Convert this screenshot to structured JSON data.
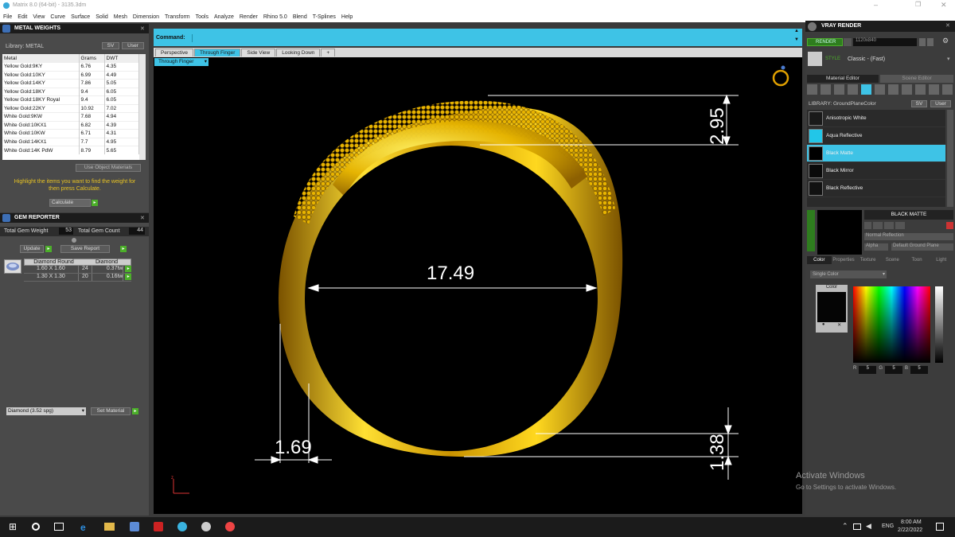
{
  "window": {
    "title": "Matrix 8.0 (64-bit) - 3135.3dm"
  },
  "menu": [
    "File",
    "Edit",
    "View",
    "Curve",
    "Surface",
    "Solid",
    "Mesh",
    "Dimension",
    "Transform",
    "Tools",
    "Analyze",
    "Render",
    "Rhino 5.0",
    "Blend",
    "T-Splines",
    "Help"
  ],
  "metal": {
    "title": "METAL WEIGHTS",
    "library": "Library: METAL",
    "sv": "SV",
    "user": "User",
    "headers": [
      "Metal",
      "Grams",
      "DWT"
    ],
    "rows": [
      [
        "Yellow Gold:9KY",
        "6.76",
        "4.35"
      ],
      [
        "Yellow Gold:10KY",
        "6.99",
        "4.49"
      ],
      [
        "Yellow Gold:14KY",
        "7.86",
        "5.05"
      ],
      [
        "Yellow Gold:18KY",
        "9.4",
        "6.05"
      ],
      [
        "Yellow Gold:18KY Royal",
        "9.4",
        "6.05"
      ],
      [
        "Yellow Gold:22KY",
        "10.92",
        "7.02"
      ],
      [
        "White Gold:9KW",
        "7.68",
        "4.94"
      ],
      [
        "White Gold:10KX1",
        "6.82",
        "4.39"
      ],
      [
        "White Gold:10KW",
        "6.71",
        "4.31"
      ],
      [
        "White Gold:14KX1",
        "7.7",
        "4.95"
      ],
      [
        "White Gold:14K PdW",
        "8.79",
        "5.65"
      ]
    ],
    "use_object": "Use Object Materials",
    "hint": "Highlight the items you want to find the weight for then press Calculate.",
    "calculate": "Calculate"
  },
  "gem": {
    "title": "GEM REPORTER",
    "total_weight_label": "Total Gem Weight",
    "total_weight": "53",
    "total_count_label": "Total Gem Count",
    "total_count": "44",
    "update": "Update",
    "save": "Save Report",
    "head": [
      "Diamond Round",
      "Diamond"
    ],
    "rows": [
      [
        "1.60 X 1.60",
        "24",
        "0.37tw"
      ],
      [
        "1.30 X 1.30",
        "20",
        "0.16tw"
      ]
    ],
    "material": "Diamond    (3.52 spg)",
    "set_material": "Set Material"
  },
  "command": {
    "label": "Command:"
  },
  "tabs": [
    "Perspective",
    "Through Finger",
    "Side View",
    "Looking Down",
    "+"
  ],
  "view_label": "Through Finger",
  "dims": {
    "top": "2.95",
    "inner": "17.49",
    "wall": "1.69",
    "bottom": "1.38"
  },
  "vray": {
    "title": "VRAY RENDER",
    "render": "RENDER",
    "resolution": "1120x840",
    "style": "STYLE",
    "style_value": "Classic - (Fast)",
    "tab_material": "Material Editor",
    "tab_scene": "Scene Editor",
    "library": "LIBRARY: GroundPlaneColor",
    "materials": [
      "Anisotropic White",
      "Aqua Reflective",
      "Black Matte",
      "Black Mirror",
      "Black Reflective"
    ],
    "selected": "BLACK MATTE",
    "reflection": "Normal Reflection",
    "alpha": "Alpha",
    "ground": "Default Ground Plane",
    "subtabs": [
      "Color",
      "Properties",
      "Texture",
      "Scene",
      "Toon",
      "Light"
    ],
    "single_color": "Single Color",
    "color_label": "Color",
    "r": "5",
    "g": "5",
    "b": "5"
  },
  "watermark": {
    "line1": "Activate Windows",
    "line2": "Go to Settings to activate Windows."
  },
  "taskbar": {
    "lang": "ENG",
    "time": "8:00 AM",
    "date": "2/22/2022"
  }
}
